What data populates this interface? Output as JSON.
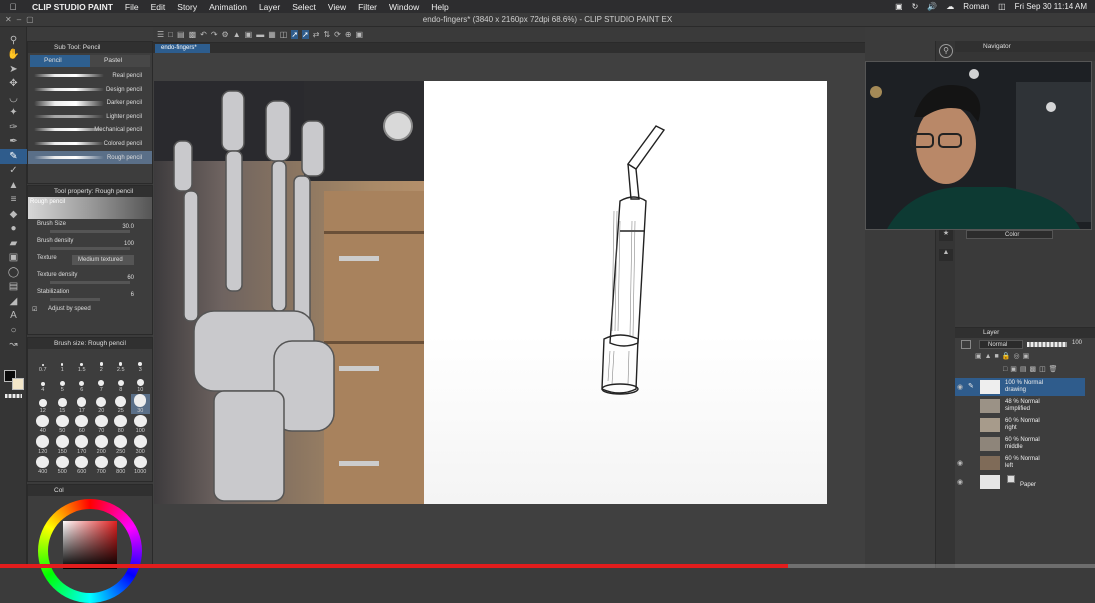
{
  "menubar": {
    "app": "CLIP STUDIO PAINT",
    "items": [
      "File",
      "Edit",
      "Story",
      "Animation",
      "Layer",
      "Select",
      "View",
      "Filter",
      "Window",
      "Help"
    ],
    "user": "Roman",
    "datetime": "Fri Sep 30  11:14 AM"
  },
  "window": {
    "title": "endo-fingers* (3840 x 2160px 72dpi 68.6%)  - CLIP STUDIO PAINT EX"
  },
  "document_tab": "endo-fingers*",
  "sub_tool": {
    "header": "Sub Tool: Pencil",
    "tabs": [
      {
        "label": "Pencil",
        "selected": true
      },
      {
        "label": "Pastel",
        "selected": false
      }
    ],
    "brushes": [
      {
        "label": "Real pencil",
        "selected": false
      },
      {
        "label": "Design pencil",
        "selected": false
      },
      {
        "label": "Darker pencil",
        "selected": false
      },
      {
        "label": "Lighter pencil",
        "selected": false
      },
      {
        "label": "Mechanical pencil",
        "selected": false
      },
      {
        "label": "Colored pencil",
        "selected": false
      },
      {
        "label": "Rough pencil",
        "selected": true
      }
    ]
  },
  "tool_property": {
    "header": "Tool property: Rough pencil",
    "preset_name": "Rough pencil",
    "brush_size_label": "Brush Size",
    "brush_size_value": "30.0",
    "brush_density_label": "Brush density",
    "brush_density_value": "100",
    "texture_label": "Texture",
    "texture_value": "Medium textured",
    "texture_density_label": "Texture density",
    "texture_density_value": "60",
    "stabilization_label": "Stabilization",
    "stabilization_value": "6",
    "adjust_label": "Adjust by speed"
  },
  "brush_size": {
    "header": "Brush size: Rough pencil",
    "sizes": [
      "0.7",
      "1",
      "1.5",
      "2",
      "2.5",
      "3",
      "4",
      "5",
      "6",
      "7",
      "8",
      "10",
      "12",
      "15",
      "17",
      "20",
      "25",
      "30",
      "40",
      "50",
      "60",
      "70",
      "80",
      "100",
      "120",
      "150",
      "170",
      "200",
      "250",
      "300",
      "400",
      "500",
      "600",
      "700",
      "800",
      "1000"
    ],
    "selected": "30"
  },
  "color_panel": {
    "header": "Col"
  },
  "navigator": {
    "header": "Navigator"
  },
  "color_dropdown": "Color",
  "layers": {
    "header": "Layer",
    "blend_mode": "Normal",
    "opacity": "100",
    "items": [
      {
        "percent": "100 %",
        "mode": "Normal",
        "name": "drawing",
        "selected": true
      },
      {
        "percent": "48 %",
        "mode": "Normal",
        "name": "simplified",
        "selected": false
      },
      {
        "percent": "60 %",
        "mode": "Normal",
        "name": "right",
        "selected": false
      },
      {
        "percent": "60 %",
        "mode": "Normal",
        "name": "middle",
        "selected": false
      },
      {
        "percent": "60 %",
        "mode": "Normal",
        "name": "left",
        "selected": false
      },
      {
        "percent": "",
        "mode": "",
        "name": "Paper",
        "selected": false
      }
    ]
  },
  "video_progress": 0.72,
  "colors": {
    "accent": "#2f5c8c",
    "progress": "#e21d1d"
  }
}
